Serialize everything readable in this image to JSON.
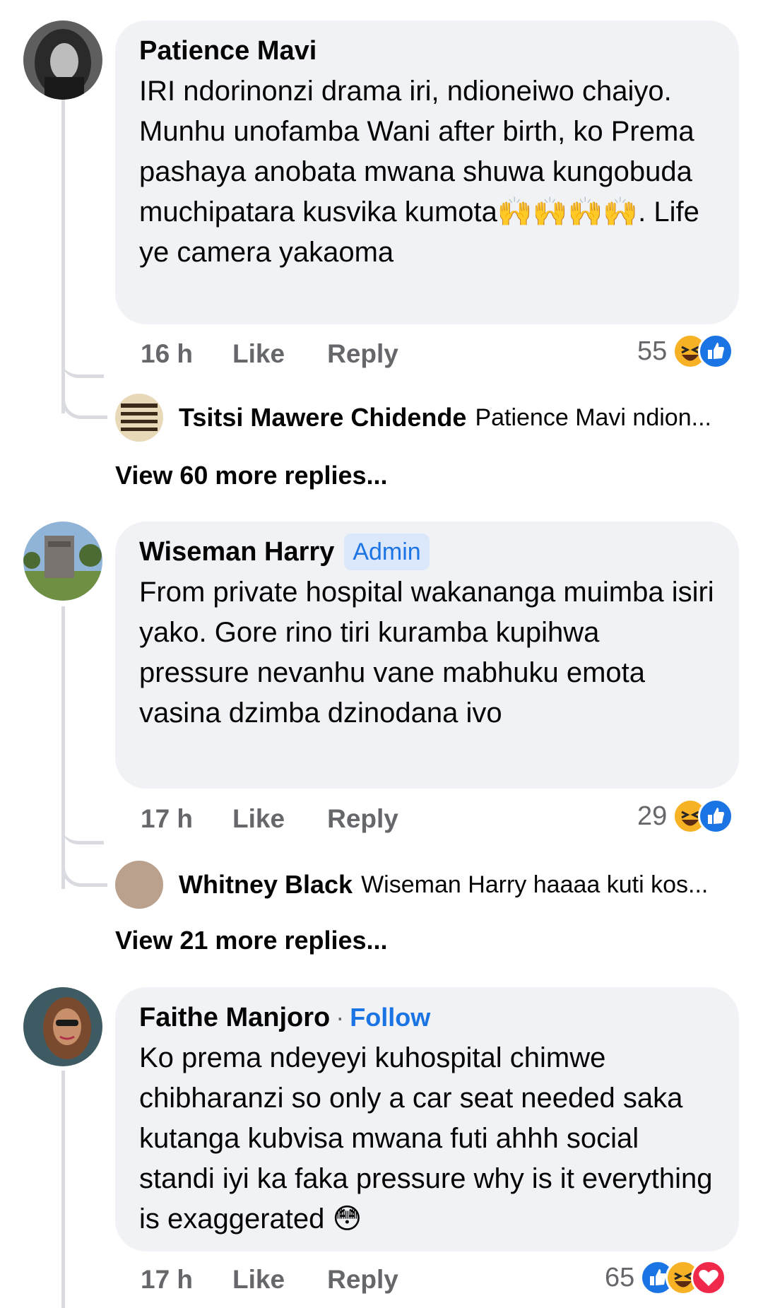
{
  "comments": [
    {
      "author": "Patience Mavi",
      "text": "IRI ndorinonzi drama iri, ndioneiwo chaiyo. Munhu unofamba Wani after birth, ko Prema pashaya anobata mwana shuwa kungobuda muchipatara kusvika kumota🙌🙌🙌🙌. Life ye camera yakaoma",
      "time": "16 h",
      "like": "Like",
      "reply": "Reply",
      "reaction_count": "55",
      "reactions": [
        "haha",
        "like"
      ],
      "reply_preview": {
        "author": "Tsitsi Mawere Chidende",
        "snippet": "Patience Mavi ndion..."
      },
      "more_replies": "View 60 more replies..."
    },
    {
      "author": "Wiseman Harry",
      "badge": "Admin",
      "text": "From private hospital wakananga muimba isiri yako. Gore rino tiri kuramba kupihwa pressure nevanhu vane mabhuku emota vasina dzimba dzinodana ivo",
      "time": "17 h",
      "like": "Like",
      "reply": "Reply",
      "reaction_count": "29",
      "reactions": [
        "haha",
        "like"
      ],
      "reply_preview": {
        "author": "Whitney Black",
        "snippet": "Wiseman Harry haaaa kuti kos..."
      },
      "more_replies": "View 21 more replies..."
    },
    {
      "author": "Faithe Manjoro",
      "separator": "·",
      "follow": "Follow",
      "text": "Ko prema ndeyeyi kuhospital chimwe chibharanzi so only a car seat needed saka kutanga kubvisa mwana futi ahhh social standi iyi ka faka pressure why is it everything is exaggerated 😳",
      "time": "17 h",
      "like": "Like",
      "reply": "Reply",
      "reaction_count": "65",
      "reactions": [
        "like",
        "haha",
        "love"
      ]
    }
  ],
  "colors": {
    "bubble": "#f0f2f5",
    "muted": "#65676b",
    "link": "#1b74e4",
    "thread_line": "#d9dbe0"
  }
}
